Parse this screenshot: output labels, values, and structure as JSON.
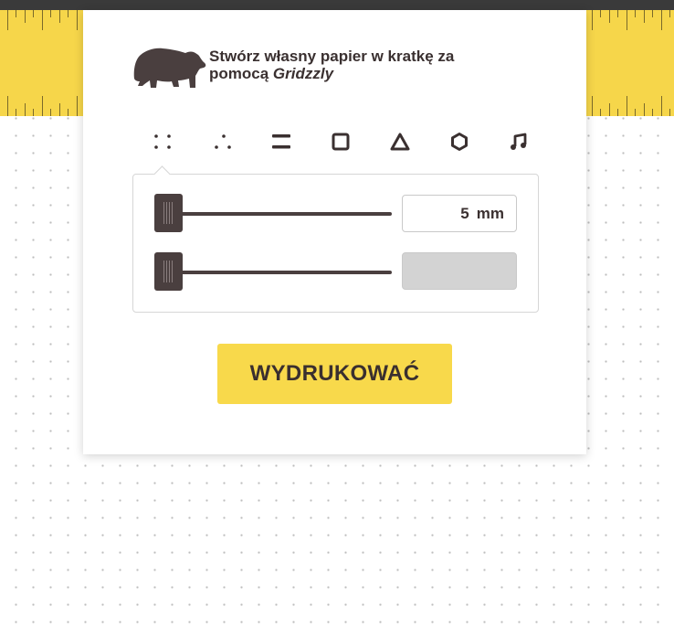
{
  "header": {
    "tagline": "Stwórz własny papier w kratkę za pomocą",
    "brand": "Gridzzly"
  },
  "pattern_tabs": [
    {
      "name": "dots",
      "icon": "four-dots-icon",
      "selected": true
    },
    {
      "name": "triangle-dots",
      "icon": "three-dots-icon",
      "selected": false
    },
    {
      "name": "lines",
      "icon": "lines-icon",
      "selected": false
    },
    {
      "name": "squares",
      "icon": "square-icon",
      "selected": false
    },
    {
      "name": "triangles",
      "icon": "triangle-icon",
      "selected": false
    },
    {
      "name": "hexagons",
      "icon": "hexagon-icon",
      "selected": false
    },
    {
      "name": "music",
      "icon": "music-note-icon",
      "selected": false
    }
  ],
  "controls": {
    "size": {
      "value": "5",
      "unit": "mm"
    },
    "second": {
      "value": ""
    }
  },
  "print_button": {
    "label": "WYDRUKOWAĆ"
  },
  "colors": {
    "accent": "#f8d94b",
    "dark": "#4a3f3f",
    "ruler": "#f6d64a"
  }
}
